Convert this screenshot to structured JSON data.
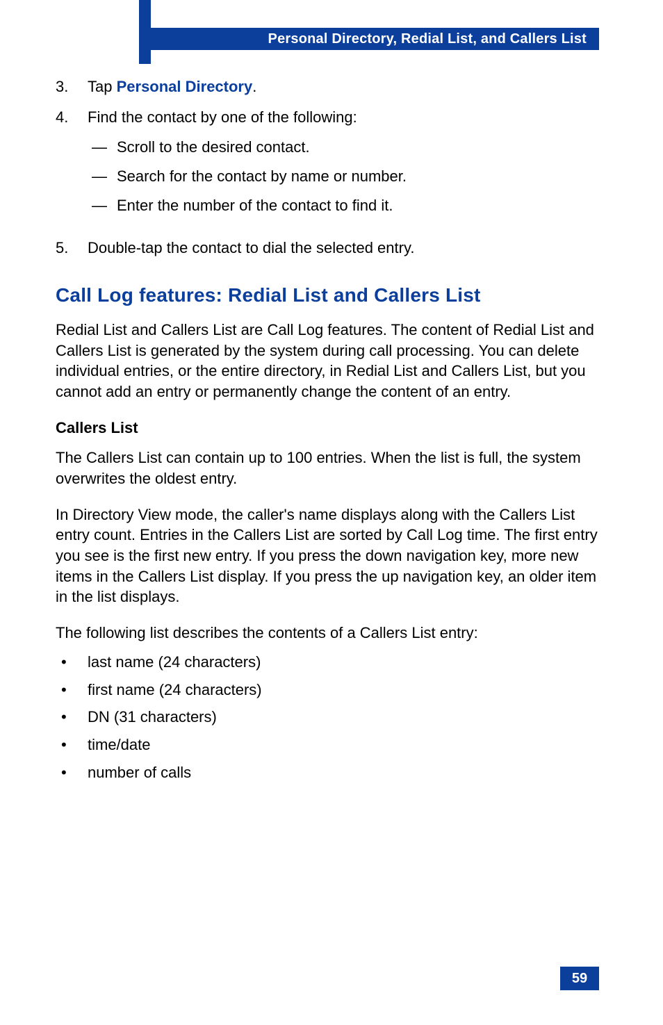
{
  "header": {
    "title": "Personal Directory, Redial List, and Callers List"
  },
  "steps": {
    "s3": {
      "num": "3.",
      "prefix": "Tap ",
      "link": "Personal Directory",
      "suffix": "."
    },
    "s4": {
      "num": "4.",
      "text": "Find the contact by one of the following:",
      "subs": {
        "a": "Scroll to the desired contact.",
        "b": "Search for the contact by name or number.",
        "c": "Enter the number of the contact to find it."
      }
    },
    "s5": {
      "num": "5.",
      "text": "Double-tap the contact to dial the selected entry."
    }
  },
  "section": {
    "heading": "Call Log features: Redial List and Callers List",
    "para1": "Redial List and Callers List are Call Log features. The content of Redial List and Callers List is generated by the system during call processing. You can delete individual entries, or the entire directory, in Redial List and Callers List, but you cannot add an entry or permanently change the content of an entry.",
    "subheading": "Callers List",
    "para2": "The Callers List can contain up to 100 entries. When the list is full, the system overwrites the oldest entry.",
    "para3": "In Directory View mode, the caller's name displays along with the Callers List entry count. Entries in the Callers List are sorted by Call Log time. The first entry you see is the first new entry. If you press the down navigation key, more new items in the Callers List display. If you press the up navigation key, an older item in the list displays.",
    "para4": "The following list describes the contents of a Callers List entry:",
    "bullets": {
      "b1": "last name (24 characters)",
      "b2": "first name (24 characters)",
      "b3": "DN (31 characters)",
      "b4": "time/date",
      "b5": "number of calls"
    }
  },
  "pageNumber": "59",
  "marks": {
    "dash": "—",
    "bullet": "•"
  }
}
